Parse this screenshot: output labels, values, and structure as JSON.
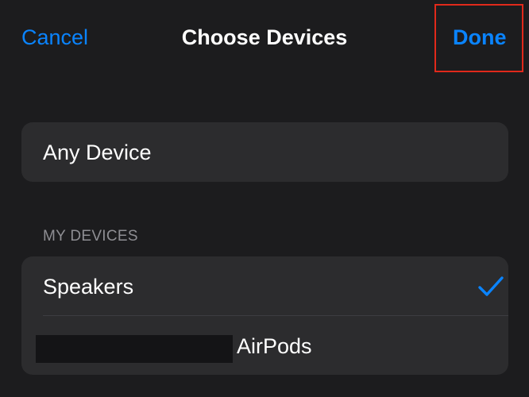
{
  "nav": {
    "cancel_label": "Cancel",
    "title": "Choose Devices",
    "done_label": "Done"
  },
  "any_device": {
    "label": "Any Device"
  },
  "my_devices": {
    "header": "MY DEVICES",
    "items": [
      {
        "label": "Speakers",
        "selected": true,
        "icon": "checkmark-icon"
      },
      {
        "label": "AirPods",
        "selected": false,
        "name_redacted": true
      }
    ]
  },
  "colors": {
    "background": "#1c1c1e",
    "card": "#2c2c2e",
    "accent": "#0a84ff",
    "secondary_text": "#8e8e93",
    "highlight": "#e0291b"
  }
}
